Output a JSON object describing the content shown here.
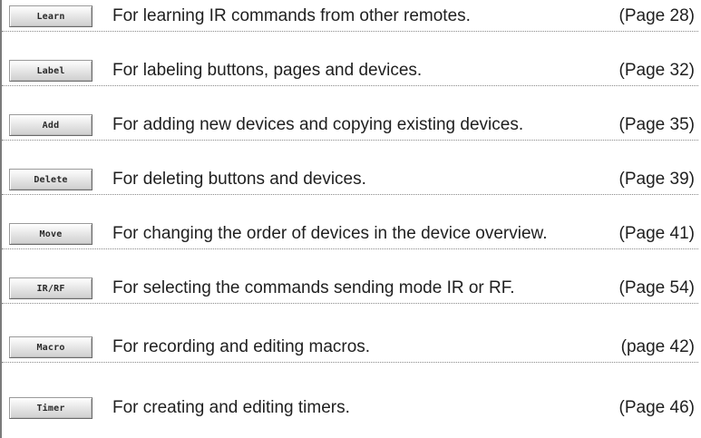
{
  "rows": [
    {
      "button": "Learn",
      "description": "For learning IR commands from other remotes.",
      "page": "(Page 28)"
    },
    {
      "button": "Label",
      "description": "For labeling buttons, pages and devices.",
      "page": "(Page 32)"
    },
    {
      "button": "Add",
      "description": "For adding new devices and copying existing devices.",
      "page": "(Page 35)"
    },
    {
      "button": "Delete",
      "description": "For deleting buttons and devices.",
      "page": "(Page 39)"
    },
    {
      "button": "Move",
      "description": "For changing the order of devices in the device overview.",
      "page": "(Page 41)"
    },
    {
      "button": "IR/RF",
      "description": "For selecting the commands sending mode IR or RF.",
      "page": "(Page 54)"
    },
    {
      "button": "Macro",
      "description": "For recording and editing macros.",
      "page": "(page 42)"
    },
    {
      "button": "Timer",
      "description": "For creating and editing timers.",
      "page": "(Page 46)"
    }
  ]
}
